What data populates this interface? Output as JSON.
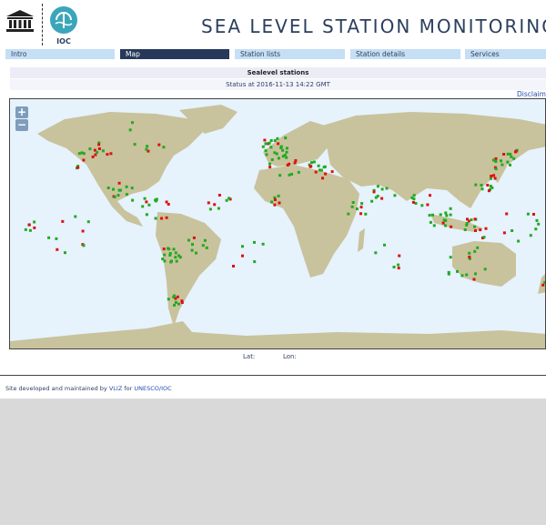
{
  "header": {
    "title": "SEA LEVEL STATION MONITORING FAC",
    "ioc_label": "IOC"
  },
  "nav": {
    "tabs": [
      {
        "label": "Intro",
        "active": false
      },
      {
        "label": "Map",
        "active": true
      },
      {
        "label": "Station lists",
        "active": false
      },
      {
        "label": "Station details",
        "active": false
      },
      {
        "label": "Services",
        "active": false
      }
    ]
  },
  "panel": {
    "title": "Sealevel stations",
    "status": "Status at 2016-11-13 14:22 GMT",
    "disclaimer": "Disclaim"
  },
  "map": {
    "zoom_in": "+",
    "zoom_out": "−",
    "ocean_color": "#e6f2fc",
    "land_color": "#c8c39c",
    "station_ok_color": "#22aa22",
    "station_down_color": "#dd1111"
  },
  "coords": {
    "lat_label": "Lat:",
    "lon_label": "Lon:"
  },
  "footer": {
    "prefix": "Site developed and maintained by",
    "vliz": "VLIZ",
    "middle": "for",
    "unesco": "UNESCO/IOC"
  }
}
